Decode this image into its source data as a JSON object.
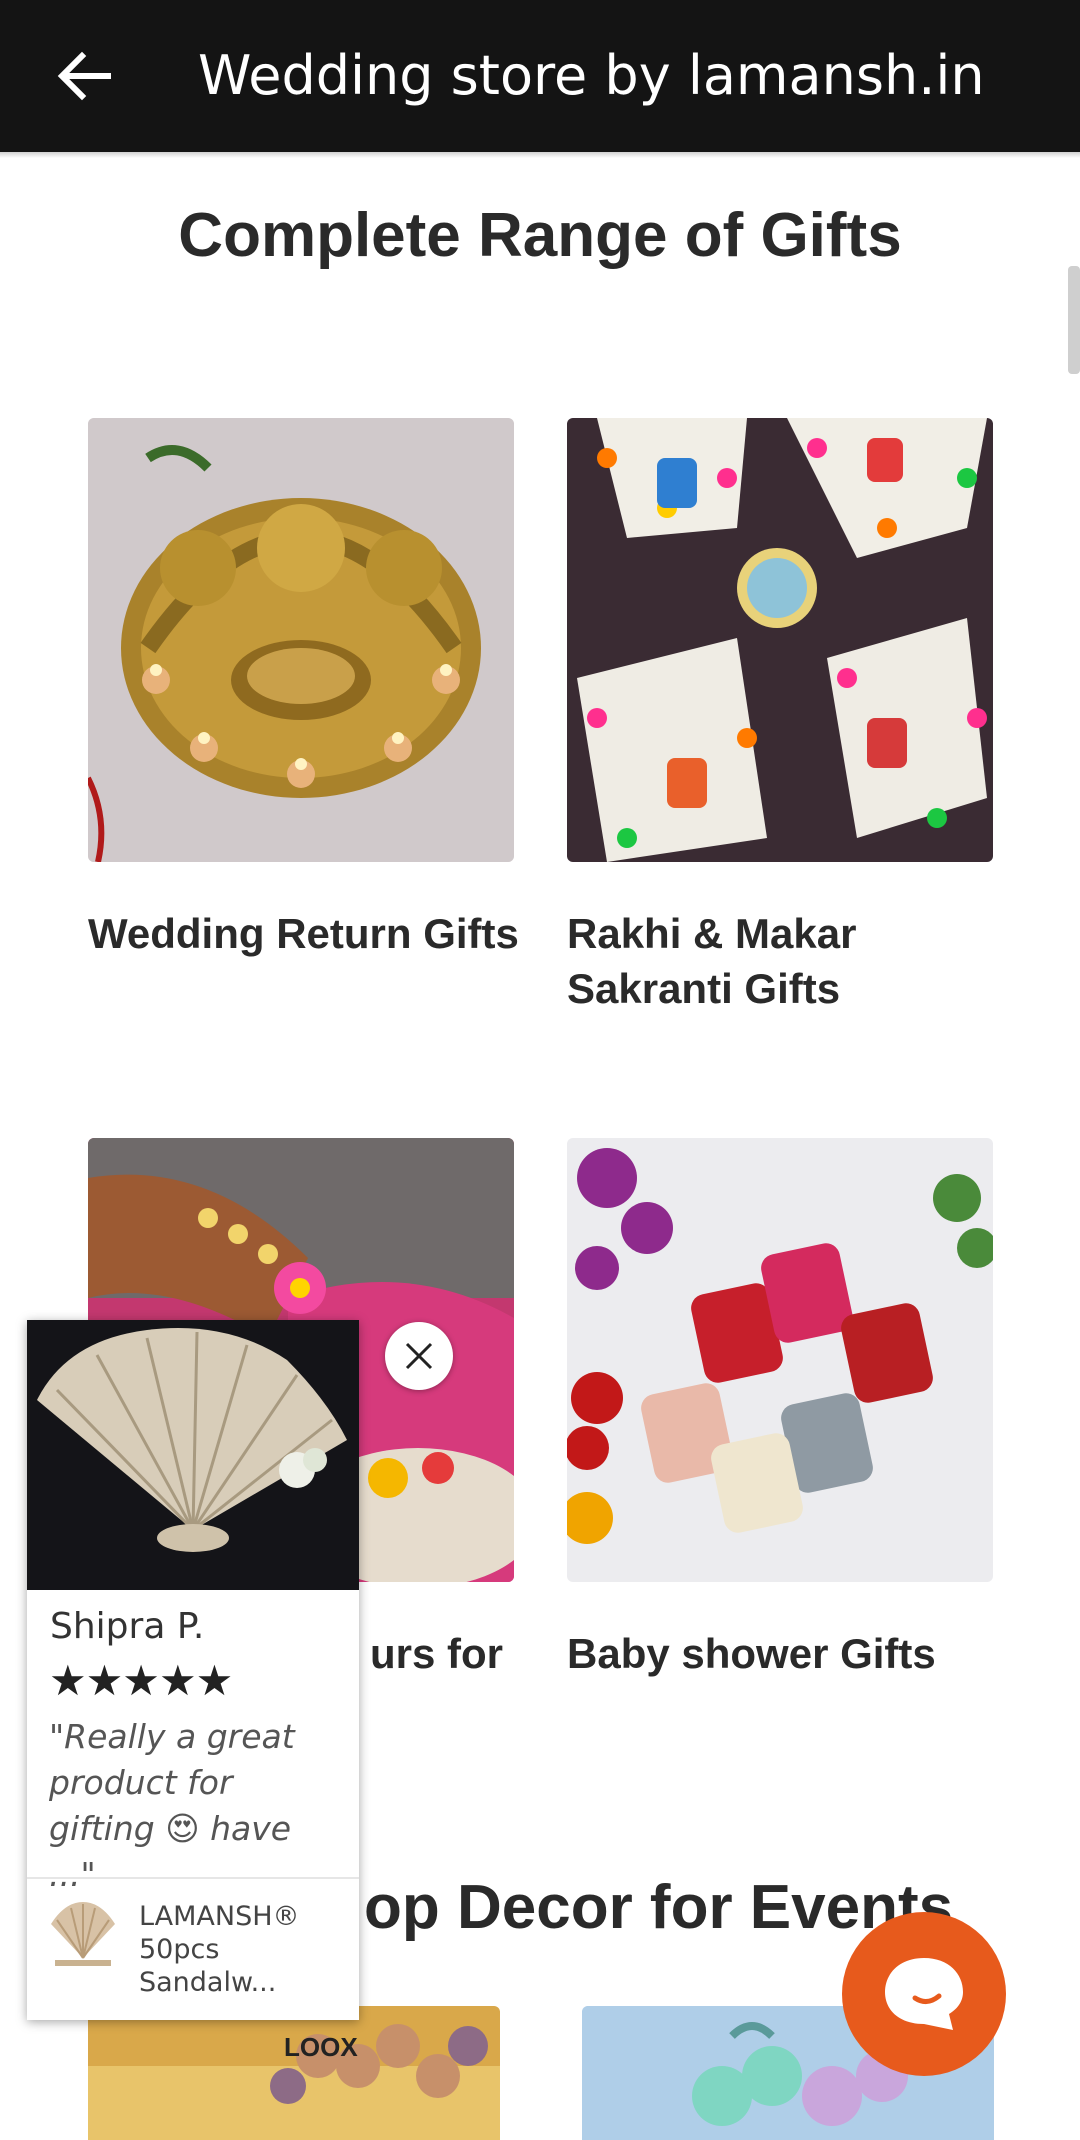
{
  "header": {
    "title": "Wedding store by lamansh.in",
    "back_icon": "arrow-left-icon"
  },
  "gifts_section": {
    "title": "Complete Range of Gifts",
    "cards": [
      {
        "label": "Wedding Return Gifts",
        "image": "brass-diya-ganesh"
      },
      {
        "label": "Rakhi & Makar Sakranti Gifts",
        "image": "potli-bags"
      },
      {
        "label": "urs for",
        "image": "mehendi-haldi-favours"
      },
      {
        "label": "Baby shower Gifts",
        "image": "embroidered-pouches"
      }
    ]
  },
  "decor_section": {
    "title": "op Decor for Events"
  },
  "review_popup": {
    "reviewer": "Shipra P.",
    "stars": "★★★★★",
    "rating": 5,
    "text": "\"Really a great product for gifting 😍 have ...\"",
    "product_name": "LAMANSH® 50pcs Sandalw...",
    "close_icon": "close-icon"
  },
  "bottom_images": [
    {
      "badge": "LOOX"
    }
  ],
  "chat": {
    "icon": "chat-bubble-icon",
    "color": "#e75a1c"
  },
  "colors": {
    "header_bg": "#141414",
    "text": "#2a2a2a",
    "chat": "#e75a1c"
  }
}
